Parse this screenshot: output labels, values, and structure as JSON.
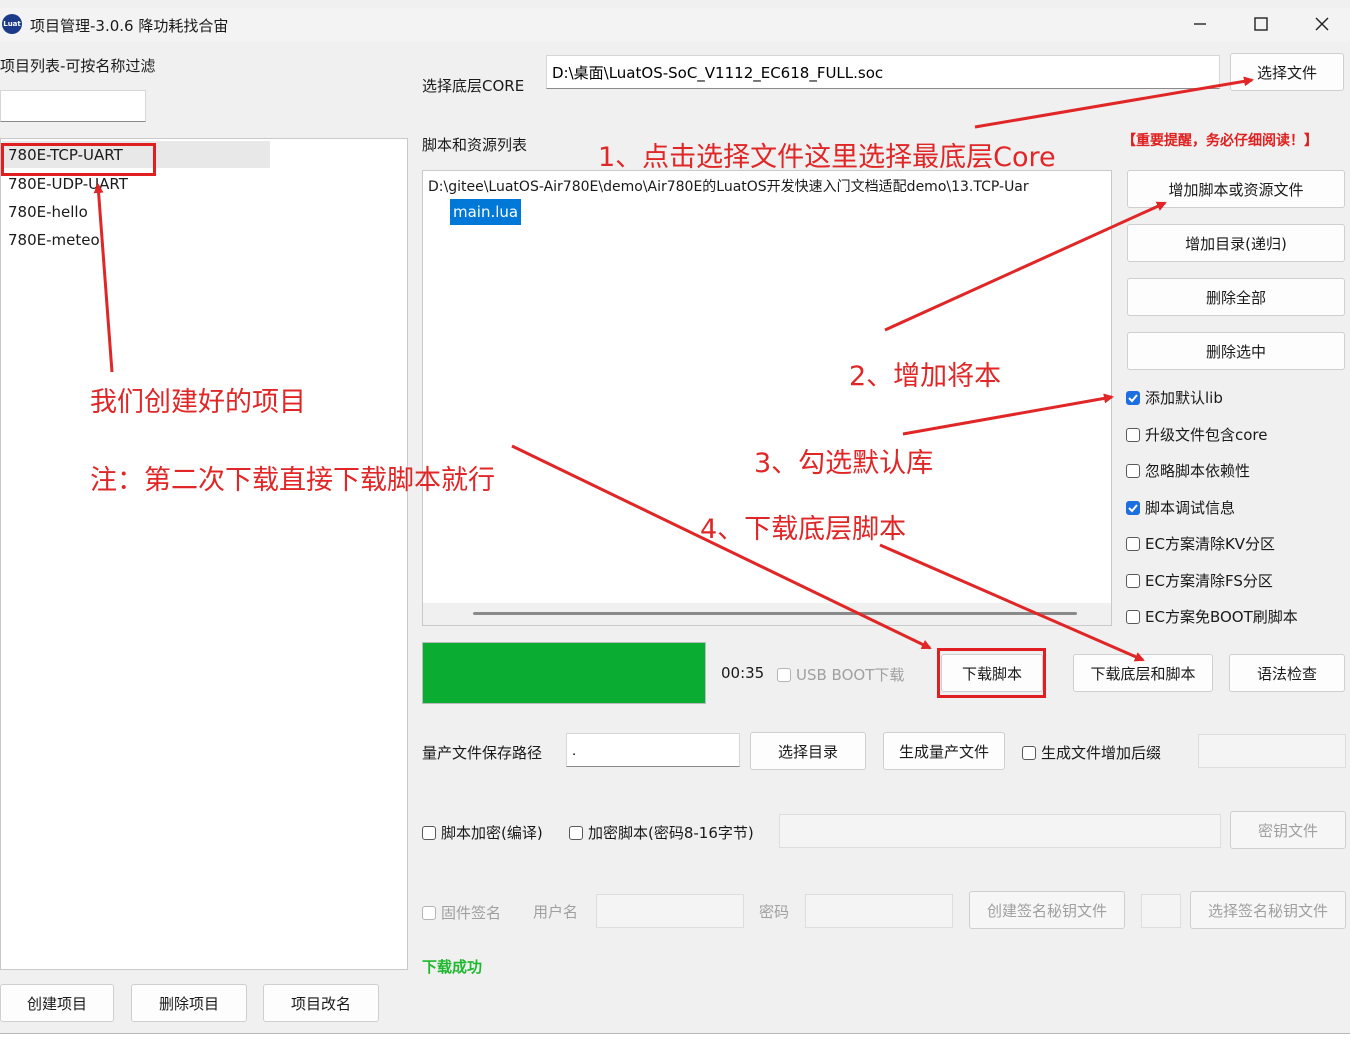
{
  "window": {
    "logo_text": "Luat",
    "title": "项目管理-3.0.6 降功耗找合宙"
  },
  "left_panel": {
    "filter_label": "项目列表-可按名称过滤",
    "filter_value": "",
    "projects": [
      "780E-TCP-UART",
      "780E-UDP-UART",
      "780E-hello",
      "780E-meteo"
    ],
    "buttons": {
      "create": "创建项目",
      "delete": "删除项目",
      "rename": "项目改名"
    }
  },
  "core": {
    "label": "选择底层CORE",
    "path": "D:\\桌面\\LuatOS-SoC_V1112_EC618_FULL.soc",
    "select_button": "选择文件"
  },
  "scripts": {
    "label": "脚本和资源列表",
    "path": "D:\\gitee\\LuatOS-Air780E\\demo\\Air780E的LuatOS开发快速入门文档适配demo\\13.TCP-Uar",
    "files": [
      "main.lua"
    ]
  },
  "notice": "【重要提醒，务必仔细阅读！】",
  "side_buttons": {
    "add_script": "增加脚本或资源文件",
    "add_dir": "增加目录(递归)",
    "delete_all": "删除全部",
    "delete_selected": "删除选中"
  },
  "options": [
    {
      "label": "添加默认lib",
      "checked": true
    },
    {
      "label": "升级文件包含core",
      "checked": false
    },
    {
      "label": "忽略脚本依赖性",
      "checked": false
    },
    {
      "label": "脚本调试信息",
      "checked": true
    },
    {
      "label": "EC方案清除KV分区",
      "checked": false
    },
    {
      "label": "EC方案清除FS分区",
      "checked": false
    },
    {
      "label": "EC方案免BOOT刷脚本",
      "checked": false
    }
  ],
  "download": {
    "progress_fraction": 1.0,
    "progress_color": "#0aad31",
    "elapsed": "00:35",
    "usb_boot_label": "USB BOOT下载",
    "download_script": "下载脚本",
    "download_core_and_script": "下载底层和脚本",
    "syntax_check": "语法检查"
  },
  "mass_production": {
    "path_label": "量产文件保存路径",
    "path_value": ".",
    "select_dir": "选择目录",
    "generate": "生成量产文件",
    "add_suffix_label": "生成文件增加后缀"
  },
  "encryption": {
    "compile_label": "脚本加密(编译)",
    "password_label": "加密脚本(密码8-16字节)",
    "key_file": "密钥文件"
  },
  "signing": {
    "firmware_sign_label": "固件签名",
    "username_label": "用户名",
    "password_label": "密码",
    "create_key": "创建签名秘钥文件",
    "select_key": "选择签名秘钥文件"
  },
  "status": {
    "text": "下载成功",
    "color": "#1fb82f"
  },
  "annotations": {
    "step1": "1、点击选择文件这里选择最底层Core",
    "step2": "2、增加将本",
    "step3": "3、勾选默认库",
    "step4": "4、下载底层脚本",
    "projects_note": "我们创建好的项目",
    "second_download_note": "注：第二次下载直接下载脚本就行",
    "color": "#e02626"
  }
}
